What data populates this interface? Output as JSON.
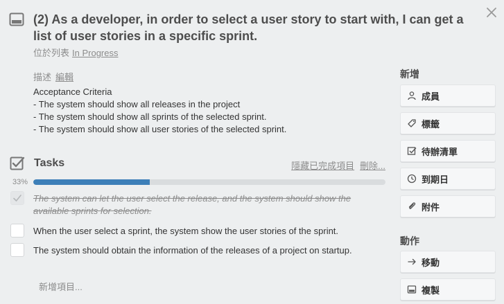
{
  "card": {
    "title": "(2) As a developer, in order to select a user story to start with, I can get a list of user stories in a specific sprint.",
    "list_prefix": "位於列表",
    "list_name": "In Progress"
  },
  "description": {
    "label": "描述",
    "edit_label": "編輯",
    "lines": [
      "Acceptance Criteria",
      "- The system should show all releases in the project",
      "- The system should show all sprints of the selected sprint.",
      "- The system should show all user stories of the selected sprint."
    ]
  },
  "checklist": {
    "title": "Tasks",
    "hide_completed_label": "隱藏已完成項目",
    "delete_label": "刪除...",
    "progress_label": "33%",
    "progress": 0.33,
    "items": [
      {
        "text": "The system can let the user select the release, and the system should show the available sprints for selection.",
        "checked": true
      },
      {
        "text": "When the user select a sprint, the system show the user stories of the sprint.",
        "checked": false
      },
      {
        "text": "The system should obtain the information of the releases of a project on startup.",
        "checked": false
      }
    ],
    "add_item_label": "新增項目..."
  },
  "sidebar": {
    "add_heading": "新增",
    "add_buttons": [
      {
        "label": "成員",
        "icon": "person-icon"
      },
      {
        "label": "標籤",
        "icon": "tag-icon"
      },
      {
        "label": "待辦清單",
        "icon": "checklist-icon"
      },
      {
        "label": "到期日",
        "icon": "clock-icon"
      },
      {
        "label": "附件",
        "icon": "paperclip-icon"
      }
    ],
    "actions_heading": "動作",
    "action_buttons": [
      {
        "label": "移動",
        "icon": "arrow-right-icon"
      },
      {
        "label": "複製",
        "icon": "copy-icon"
      }
    ]
  },
  "colors": {
    "background": "#edeff0",
    "progress_fill": "#3d7fb8",
    "progress_track": "#d9dcde"
  }
}
